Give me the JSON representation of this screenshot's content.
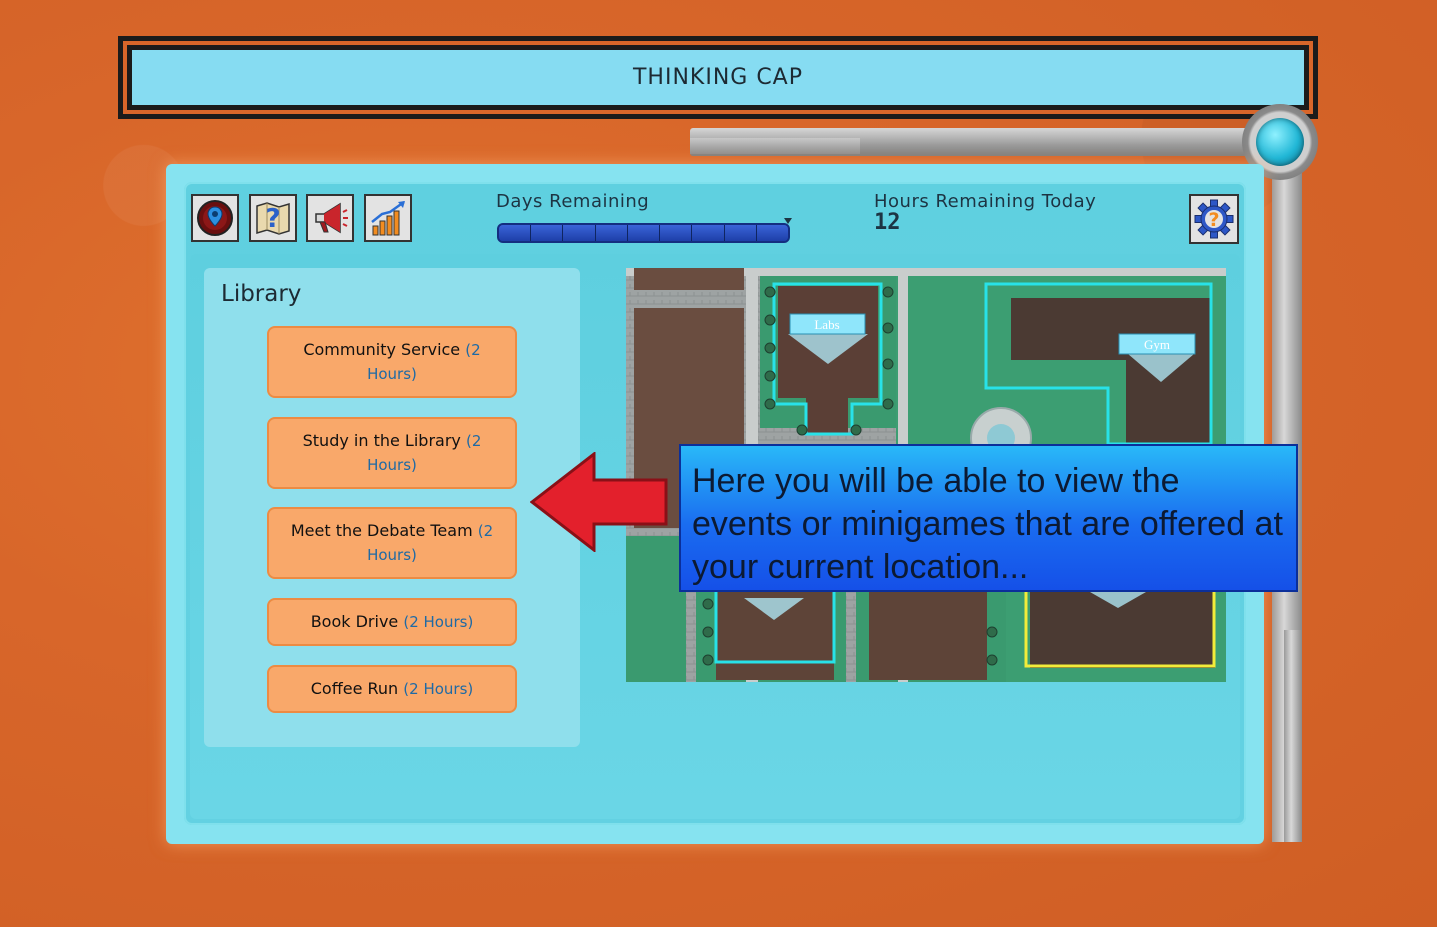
{
  "header": {
    "title": "THINKING CAP"
  },
  "toolbar": {
    "buttons": [
      {
        "icon": "map-pin-icon"
      },
      {
        "icon": "quest-map-icon"
      },
      {
        "icon": "megaphone-icon"
      },
      {
        "icon": "stats-chart-icon"
      }
    ],
    "settings_icon": "help-gear-icon"
  },
  "status": {
    "days_label": "Days Remaining",
    "days_segments": 9,
    "hours_label": "Hours Remaining Today",
    "hours_value": "12"
  },
  "location": {
    "name": "Library",
    "events": [
      {
        "name": "Community Service",
        "duration": "(2 Hours)"
      },
      {
        "name": "Study in the Library",
        "duration": "(2 Hours)"
      },
      {
        "name": "Meet the Debate Team",
        "duration": "(2 Hours)"
      },
      {
        "name": "Book Drive",
        "duration": "(2 Hours)"
      },
      {
        "name": "Coffee Run",
        "duration": "(2 Hours)"
      }
    ]
  },
  "map": {
    "labels": [
      "Labs",
      "Gym"
    ]
  },
  "tutorial": {
    "text": "Here you will be able to view the events or minigames that are offered at your current location..."
  },
  "colors": {
    "background": "#d8662a",
    "panel": "#86e3f0",
    "event_button": "#f9a86a",
    "tooltip": "#1a6cf0",
    "arrow": "#e3202c"
  }
}
